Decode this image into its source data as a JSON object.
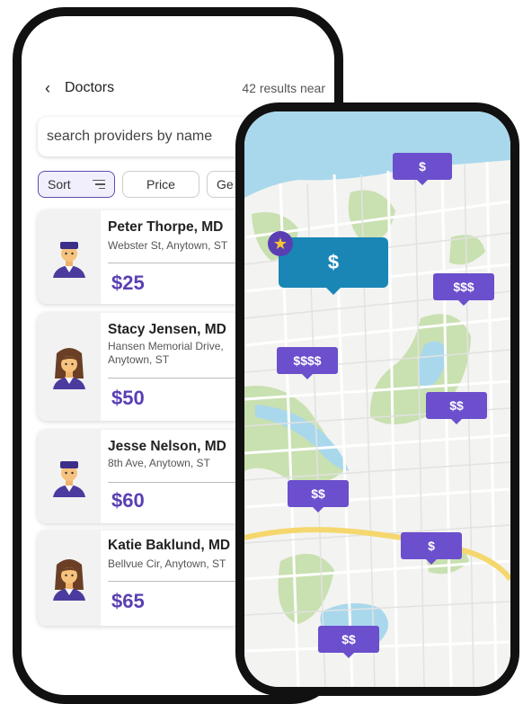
{
  "list": {
    "title": "Doctors",
    "results": "42 results near",
    "search_placeholder": "search providers by name",
    "filters": {
      "sort": "Sort",
      "price": "Price",
      "third": "Ge"
    },
    "doctors": [
      {
        "name": "Peter Thorpe, MD",
        "address": "Webster St, Anytown, ST",
        "price": "$25",
        "gender": "male"
      },
      {
        "name": "Stacy Jensen, MD",
        "address": "Hansen Memorial Drive, Anytown, ST",
        "price": "$50",
        "gender": "female"
      },
      {
        "name": "Jesse Nelson, MD",
        "address": "8th Ave, Anytown, ST",
        "price": "$60",
        "gender": "male"
      },
      {
        "name": "Katie Baklund, MD",
        "address": "Bellvue Cir, Anytown, ST",
        "price": "$65",
        "gender": "female"
      }
    ]
  },
  "map": {
    "pins": [
      "$",
      "$",
      "$$$",
      "$$$$",
      "$$",
      "$$",
      "$",
      "$$"
    ]
  },
  "colors": {
    "accent": "#5a3fb3",
    "pin": "#6b4fcc",
    "selected_pin": "#1a86b6",
    "water": "#a9d8ec",
    "park": "#c9e0b0",
    "highway": "#f5d76e"
  }
}
